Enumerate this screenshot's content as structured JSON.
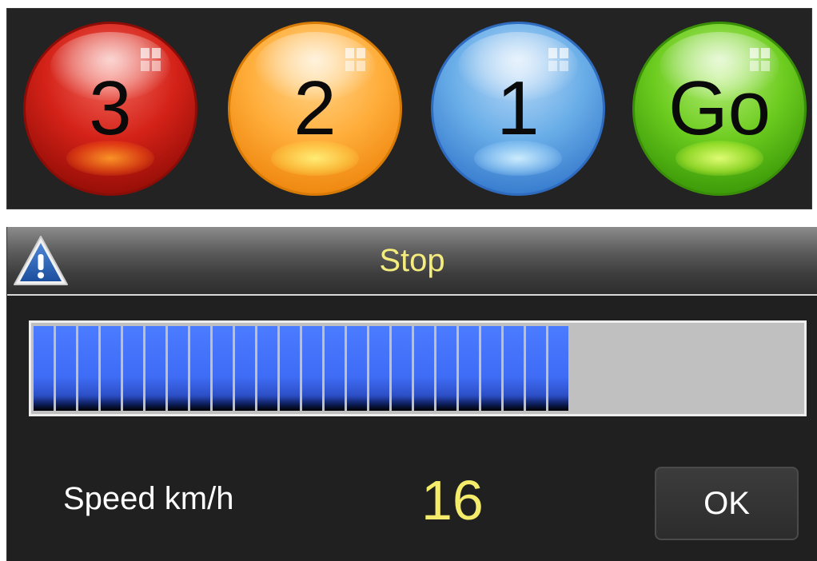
{
  "countdown": {
    "lights": [
      {
        "label": "3",
        "color": "#d42218"
      },
      {
        "label": "2",
        "color": "#ffae3c"
      },
      {
        "label": "1",
        "color": "#6aaee8"
      },
      {
        "label": "Go",
        "color": "#6dcc1f"
      }
    ]
  },
  "dialog": {
    "title": "Stop",
    "title_color": "#f4ec7c",
    "icon": "warning-icon",
    "progress": {
      "fraction": 0.69,
      "segments_filled": 24,
      "fill_color": "#3f6cf6"
    },
    "speed_label": "Speed km/h",
    "speed_value": "16",
    "ok_label": "OK"
  }
}
